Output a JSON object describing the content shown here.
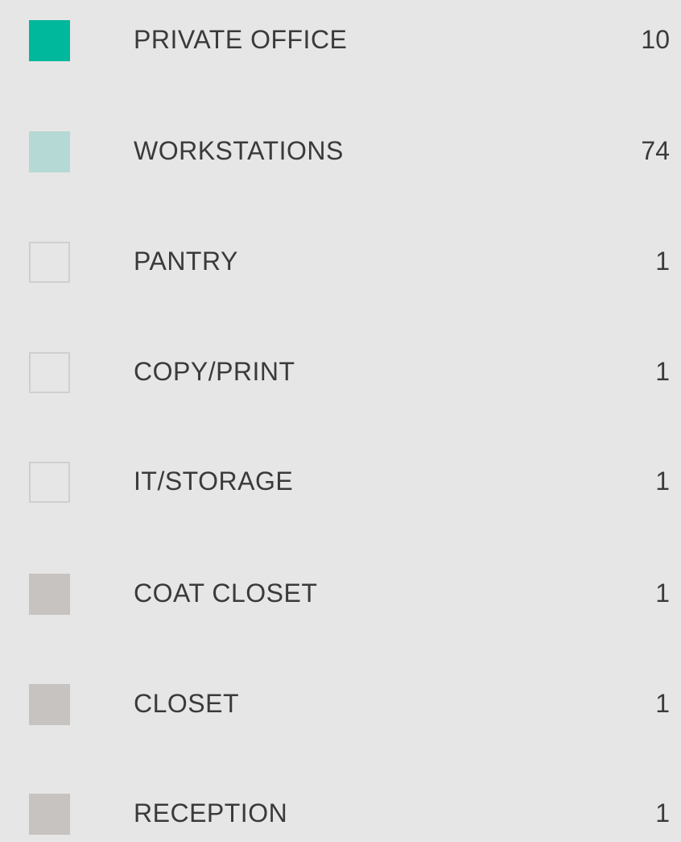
{
  "legend": {
    "items": [
      {
        "label": "PRIVATE OFFICE",
        "count": "10",
        "swatch_color": "#00b89c",
        "swatch_style": "filled"
      },
      {
        "label": "WORKSTATIONS",
        "count": "74",
        "swatch_color": "#b5d9d5",
        "swatch_style": "filled"
      },
      {
        "label": "PANTRY",
        "count": "1",
        "swatch_color": "#cfcfcf",
        "swatch_style": "outline"
      },
      {
        "label": "COPY/PRINT",
        "count": "1",
        "swatch_color": "#cfcfcf",
        "swatch_style": "outline"
      },
      {
        "label": "IT/STORAGE",
        "count": "1",
        "swatch_color": "#cfcfcf",
        "swatch_style": "outline"
      },
      {
        "label": "COAT CLOSET",
        "count": "1",
        "swatch_color": "#c6c3c0",
        "swatch_style": "filled"
      },
      {
        "label": "CLOSET",
        "count": "1",
        "swatch_color": "#c6c3c0",
        "swatch_style": "filled"
      },
      {
        "label": "RECEPTION",
        "count": "1",
        "swatch_color": "#c6c3c0",
        "swatch_style": "filled"
      }
    ]
  }
}
